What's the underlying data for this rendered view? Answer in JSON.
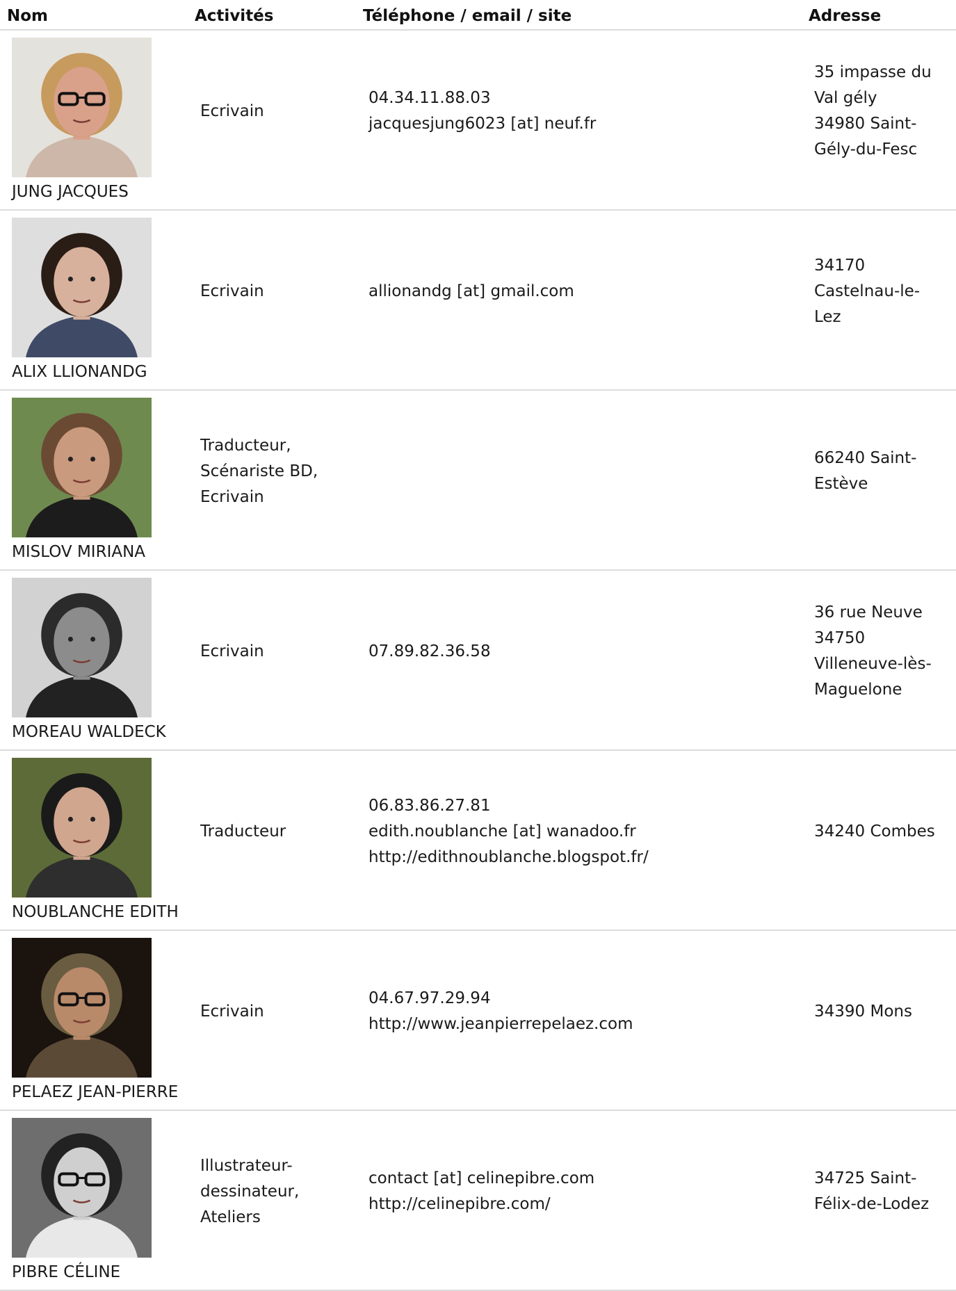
{
  "headers": {
    "nom": "Nom",
    "activites": "Activités",
    "contact": "Téléphone / email / site",
    "adresse": "Adresse"
  },
  "rows": [
    {
      "name": "JUNG JACQUES",
      "activities": [
        "Ecrivain"
      ],
      "contact": [
        "04.34.11.88.03",
        "jacquesjung6023 [at] neuf.fr"
      ],
      "address": [
        "35 impasse du",
        "Val gély",
        "34980 Saint-",
        "Gély-du-Fesc"
      ]
    },
    {
      "name": "ALIX LLIONANDG",
      "activities": [
        "Ecrivain"
      ],
      "contact": [
        "allionandg [at] gmail.com"
      ],
      "address": [
        "34170",
        "Castelnau-le-",
        "Lez"
      ]
    },
    {
      "name": "MISLOV MIRIANA",
      "activities": [
        "Traducteur,",
        "Scénariste BD,",
        "Ecrivain"
      ],
      "contact": [],
      "address": [
        "66240 Saint-",
        "Estève"
      ]
    },
    {
      "name": "MOREAU WALDECK",
      "activities": [
        "Ecrivain"
      ],
      "contact": [
        "07.89.82.36.58"
      ],
      "address": [
        "36 rue Neuve",
        "34750",
        "Villeneuve-lès-",
        "Maguelone"
      ]
    },
    {
      "name": "NOUBLANCHE EDITH",
      "activities": [
        "Traducteur"
      ],
      "contact": [
        "06.83.86.27.81",
        "edith.noublanche [at] wanadoo.fr",
        "http://edithnoublanche.blogspot.fr/"
      ],
      "address": [
        "34240 Combes"
      ]
    },
    {
      "name": "PELAEZ JEAN-PIERRE",
      "activities": [
        "Ecrivain"
      ],
      "contact": [
        "04.67.97.29.94",
        "http://www.jeanpierrepelaez.com"
      ],
      "address": [
        "34390 Mons"
      ]
    },
    {
      "name": "PIBRE CÉLINE",
      "activities": [
        "Illustrateur-",
        "dessinateur,",
        "Ateliers"
      ],
      "contact": [
        "contact [at] celinepibre.com",
        "http://celinepibre.com/"
      ],
      "address": [
        "34725 Saint-",
        "Félix-de-Lodez"
      ]
    }
  ],
  "photos": [
    {
      "bg": "#e4e2dc",
      "skin": "#d9a08a",
      "hair": "#c79a5e",
      "shirt": "#cdb7a8",
      "glasses": true
    },
    {
      "bg": "#dedede",
      "skin": "#d8b19c",
      "hair": "#2a1d16",
      "shirt": "#3f4a66",
      "glasses": false
    },
    {
      "bg": "#6f8a4f",
      "skin": "#c99a7e",
      "hair": "#6b4a33",
      "shirt": "#1c1c1c",
      "glasses": false
    },
    {
      "bg": "#d2d2d2",
      "skin": "#8c8c8c",
      "hair": "#2b2b2b",
      "shirt": "#222222",
      "glasses": false
    },
    {
      "bg": "#5d6b38",
      "skin": "#d1a68f",
      "hair": "#1a1a1a",
      "shirt": "#2e2e2e",
      "glasses": false
    },
    {
      "bg": "#1a130e",
      "skin": "#b98a6a",
      "hair": "#6a5c40",
      "shirt": "#5b4a36",
      "glasses": true
    },
    {
      "bg": "#6e6e6e",
      "skin": "#cfcfcf",
      "hair": "#222222",
      "shirt": "#e8e8e8",
      "glasses": true
    }
  ]
}
